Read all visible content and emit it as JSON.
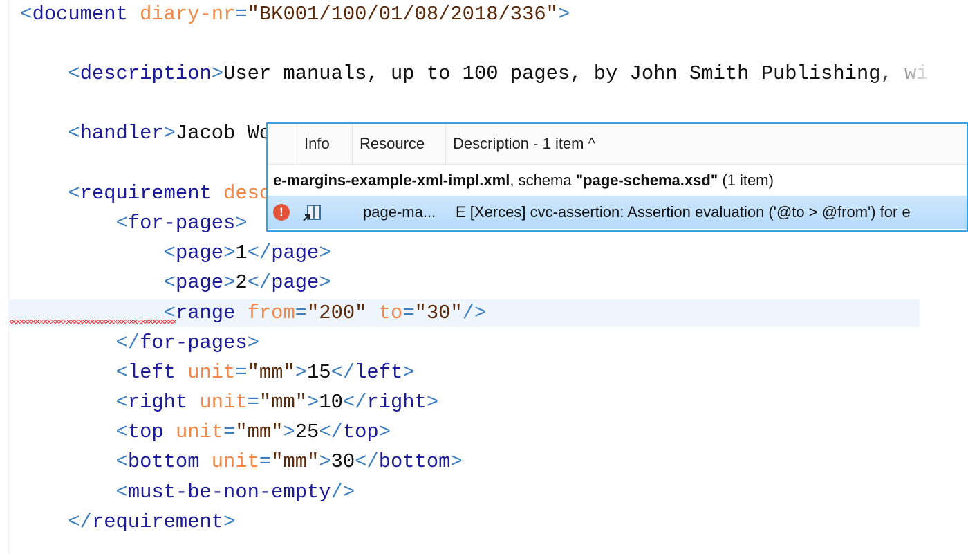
{
  "editor": {
    "lines": [
      {
        "indent": 0,
        "tokens": [
          [
            "b",
            "<"
          ],
          [
            "t",
            "document"
          ],
          [
            "x",
            " "
          ],
          [
            "a",
            "diary-nr"
          ],
          [
            "b",
            "="
          ],
          [
            "v",
            "\"BK001/100/01/08/2018/336\""
          ],
          [
            "b",
            ">"
          ]
        ]
      },
      {
        "indent": 4,
        "tokens": [
          [
            "b",
            "<"
          ],
          [
            "t",
            "description"
          ],
          [
            "b",
            ">"
          ],
          [
            "x",
            "User manuals, up to 100 pages, by John Smith Publishing, wi"
          ]
        ]
      },
      {
        "indent": 4,
        "tokens": [
          [
            "b",
            "<"
          ],
          [
            "t",
            "handler"
          ],
          [
            "b",
            ">"
          ],
          [
            "x",
            "Jacob Worker"
          ],
          [
            "b",
            "</"
          ],
          [
            "t",
            "handler"
          ],
          [
            "b",
            ">"
          ]
        ]
      },
      {
        "indent": 4,
        "tokens": [
          [
            "b",
            "<"
          ],
          [
            "t",
            "requirement"
          ],
          [
            "x",
            " "
          ],
          [
            "a",
            "descri"
          ]
        ]
      },
      {
        "indent": 8,
        "tokens": [
          [
            "b",
            "<"
          ],
          [
            "t",
            "for-pages"
          ],
          [
            "b",
            ">"
          ]
        ]
      },
      {
        "indent": 12,
        "tokens": [
          [
            "b",
            "<"
          ],
          [
            "t",
            "page"
          ],
          [
            "b",
            ">"
          ],
          [
            "x",
            "1"
          ],
          [
            "b",
            "</"
          ],
          [
            "t",
            "page"
          ],
          [
            "b",
            ">"
          ]
        ]
      },
      {
        "indent": 12,
        "tokens": [
          [
            "b",
            "<"
          ],
          [
            "t",
            "page"
          ],
          [
            "b",
            ">"
          ],
          [
            "x",
            "2"
          ],
          [
            "b",
            "</"
          ],
          [
            "t",
            "page"
          ],
          [
            "b",
            ">"
          ]
        ]
      },
      {
        "indent": 12,
        "current": true,
        "tokens": [
          [
            "b",
            "<"
          ],
          [
            "t",
            "range"
          ],
          [
            "x",
            " "
          ],
          [
            "a",
            "from"
          ],
          [
            "b",
            "="
          ],
          [
            "v",
            "\"200\""
          ],
          [
            "x",
            " "
          ],
          [
            "a",
            "to"
          ],
          [
            "b",
            "="
          ],
          [
            "v",
            "\"30\""
          ],
          [
            "b",
            "/>"
          ]
        ]
      },
      {
        "indent": 8,
        "tokens": [
          [
            "b",
            "</"
          ],
          [
            "t",
            "for-pages"
          ],
          [
            "b",
            ">"
          ]
        ]
      },
      {
        "indent": 8,
        "tokens": [
          [
            "b",
            "<"
          ],
          [
            "t",
            "left"
          ],
          [
            "x",
            " "
          ],
          [
            "a",
            "unit"
          ],
          [
            "b",
            "="
          ],
          [
            "v",
            "\"mm\""
          ],
          [
            "b",
            ">"
          ],
          [
            "x",
            "15"
          ],
          [
            "b",
            "</"
          ],
          [
            "t",
            "left"
          ],
          [
            "b",
            ">"
          ]
        ]
      },
      {
        "indent": 8,
        "tokens": [
          [
            "b",
            "<"
          ],
          [
            "t",
            "right"
          ],
          [
            "x",
            " "
          ],
          [
            "a",
            "unit"
          ],
          [
            "b",
            "="
          ],
          [
            "v",
            "\"mm\""
          ],
          [
            "b",
            ">"
          ],
          [
            "x",
            "10"
          ],
          [
            "b",
            "</"
          ],
          [
            "t",
            "right"
          ],
          [
            "b",
            ">"
          ]
        ]
      },
      {
        "indent": 8,
        "tokens": [
          [
            "b",
            "<"
          ],
          [
            "t",
            "top"
          ],
          [
            "x",
            " "
          ],
          [
            "a",
            "unit"
          ],
          [
            "b",
            "="
          ],
          [
            "v",
            "\"mm\""
          ],
          [
            "b",
            ">"
          ],
          [
            "x",
            "25"
          ],
          [
            "b",
            "</"
          ],
          [
            "t",
            "top"
          ],
          [
            "b",
            ">"
          ]
        ]
      },
      {
        "indent": 8,
        "tokens": [
          [
            "b",
            "<"
          ],
          [
            "t",
            "bottom"
          ],
          [
            "x",
            " "
          ],
          [
            "a",
            "unit"
          ],
          [
            "b",
            "="
          ],
          [
            "v",
            "\"mm\""
          ],
          [
            "b",
            ">"
          ],
          [
            "x",
            "30"
          ],
          [
            "b",
            "</"
          ],
          [
            "t",
            "bottom"
          ],
          [
            "b",
            ">"
          ]
        ]
      },
      {
        "indent": 8,
        "tokens": [
          [
            "b",
            "<"
          ],
          [
            "t",
            "must-be-non-empty"
          ],
          [
            "b",
            "/>"
          ]
        ]
      },
      {
        "indent": 4,
        "tokens": [
          [
            "b",
            "</"
          ],
          [
            "t",
            "requirement"
          ],
          [
            "b",
            ">"
          ]
        ]
      }
    ]
  },
  "problems": {
    "columns": {
      "info": "Info",
      "resource": "Resource",
      "description": "Description - 1 item ^"
    },
    "group": {
      "file": "e-margins-example-xml-impl.xml",
      "sep": ", schema ",
      "schema": "\"page-schema.xsd\"",
      "count": " (1 item)"
    },
    "row": {
      "icon": "error-icon",
      "resource_icon": "book-link-icon",
      "resource": "page-ma...",
      "description": "E [Xerces] cvc-assertion: Assertion evaluation ('@to > @from') for e"
    }
  },
  "colors": {
    "tag_bracket": "#3f7fbf",
    "tag_name": "#1c1c96",
    "attribute": "#f0884a",
    "selection": "#b5dbfb",
    "popup_border": "#3aa0e0",
    "error": "#e2533a"
  }
}
